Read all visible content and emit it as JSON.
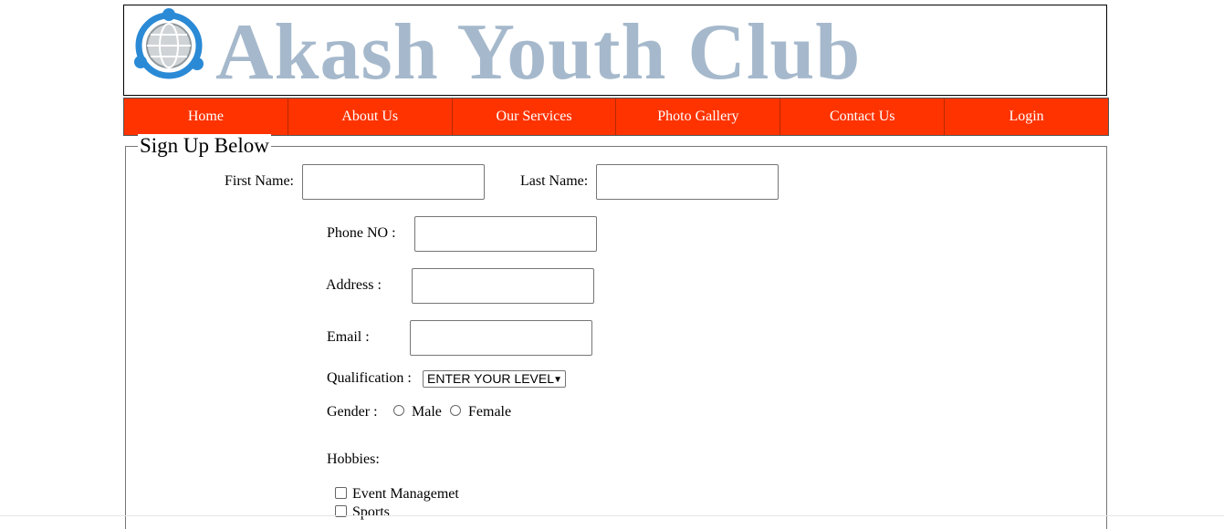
{
  "site": {
    "title": "Akash Youth Club",
    "logo_icon": "globe-people-icon",
    "title_color": "#a6b9cc"
  },
  "nav": {
    "background": "#ff3300",
    "items": [
      "Home",
      "About Us",
      "Our Services",
      "Photo Gallery",
      "Contact Us",
      "Login"
    ]
  },
  "form": {
    "legend": "Sign Up Below",
    "first_name_label": "First Name:",
    "first_name_value": "",
    "last_name_label": "Last Name:",
    "last_name_value": "",
    "phone_label": "Phone NO :",
    "phone_value": "",
    "address_label": "Address :",
    "address_value": "",
    "email_label": "Email :",
    "email_value": "",
    "qualification_label": "Qualification :",
    "qualification_selected": "ENTER YOUR LEVEL",
    "gender_label": "Gender :",
    "gender_options": [
      "Male",
      "Female"
    ],
    "hobbies_label": "Hobbies:",
    "hobbies": [
      "Event Managemet",
      "Sports"
    ]
  }
}
